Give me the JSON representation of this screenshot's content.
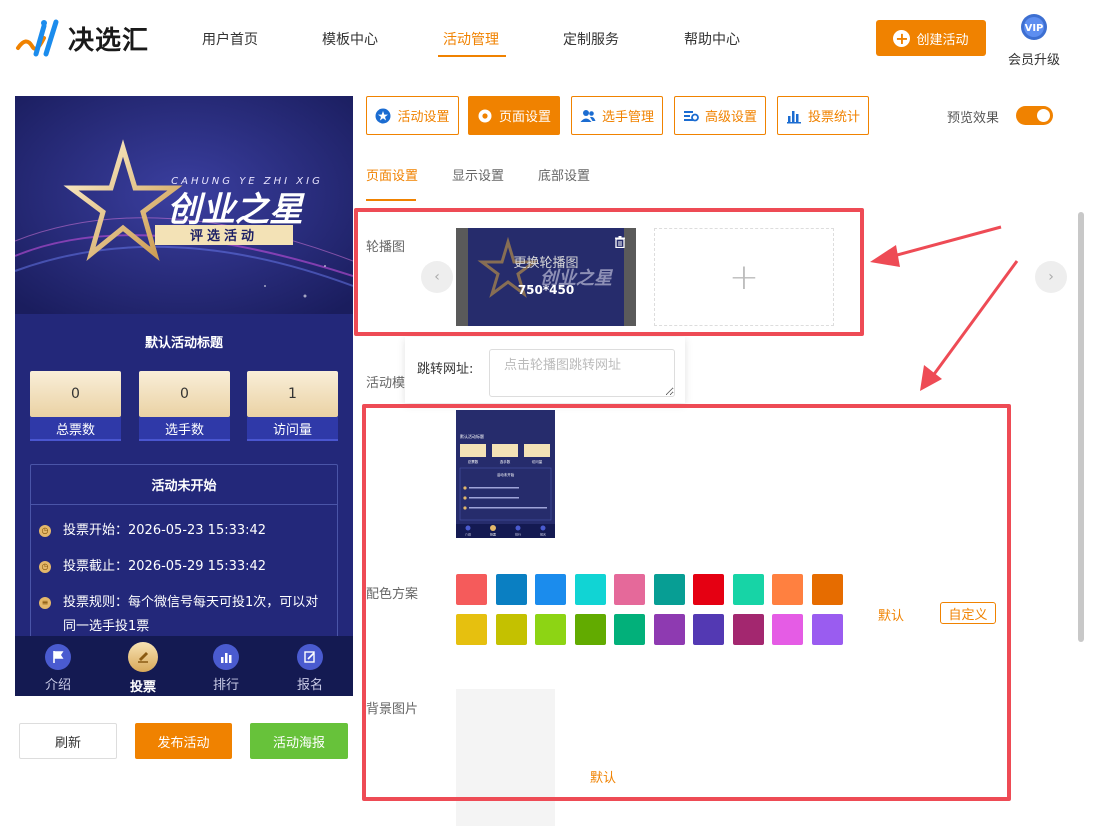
{
  "header": {
    "brand": "决选汇",
    "nav": [
      "用户首页",
      "模板中心",
      "活动管理",
      "定制服务",
      "帮助中心"
    ],
    "active_nav": "活动管理",
    "create_label": "创建活动",
    "vip_badge": "VIP",
    "vip_label": "会员升级"
  },
  "preview": {
    "banner_pinyin": "CAHUNG YE ZHI XIG",
    "banner_title": "创业之星",
    "banner_subtitle": "评选活动",
    "title": "默认活动标题",
    "stats": [
      {
        "value": "0",
        "label": "总票数"
      },
      {
        "value": "0",
        "label": "选手数"
      },
      {
        "value": "1",
        "label": "访问量"
      }
    ],
    "status": "活动未开始",
    "info": [
      "投票开始：2026-05-23 15:33:42",
      "投票截止：2026-05-29 15:33:42",
      "投票规则：每个微信号每天可投1次，可以对同一选手投1票"
    ],
    "tabs": [
      "介绍",
      "投票",
      "排行",
      "报名"
    ],
    "active_tab": "投票"
  },
  "actions": {
    "refresh": "刷新",
    "publish": "发布活动",
    "poster": "活动海报"
  },
  "toolbar": {
    "buttons": [
      "活动设置",
      "页面设置",
      "选手管理",
      "高级设置",
      "投票统计"
    ],
    "active": "页面设置",
    "preview_label": "预览效果",
    "preview_on": true
  },
  "subtabs": [
    "页面设置",
    "显示设置",
    "底部设置"
  ],
  "settings": {
    "carousel_label": "轮播图",
    "carousel_change": "更换轮播图",
    "carousel_size": "750*450",
    "jump_label": "跳转网址:",
    "jump_placeholder": "点击轮播图跳转网址",
    "template_label": "活动模",
    "color_label": "配色方案",
    "colors": [
      "#f55b5b",
      "#0a7fc2",
      "#1b8ced",
      "#11d4d4",
      "#e5699a",
      "#079e94",
      "#e50012",
      "#17d4a6",
      "#ff8040",
      "#e66c00",
      "#e6c00f",
      "#c4c100",
      "#8dd414",
      "#62ab00",
      "#02b07a",
      "#8e3ab1",
      "#5339b3",
      "#a3276f",
      "#e55ce5",
      "#9a5cf0"
    ],
    "color_default": "默认",
    "color_custom": "自定义",
    "bg_label": "背景图片",
    "bg_default": "默认"
  },
  "thumbnail": {
    "title": "默认活动标题",
    "stats": [
      "总票数",
      "选手数",
      "访问量"
    ],
    "status": "活动未开始",
    "tabs": [
      "介绍",
      "投票",
      "排行",
      "报名"
    ]
  }
}
